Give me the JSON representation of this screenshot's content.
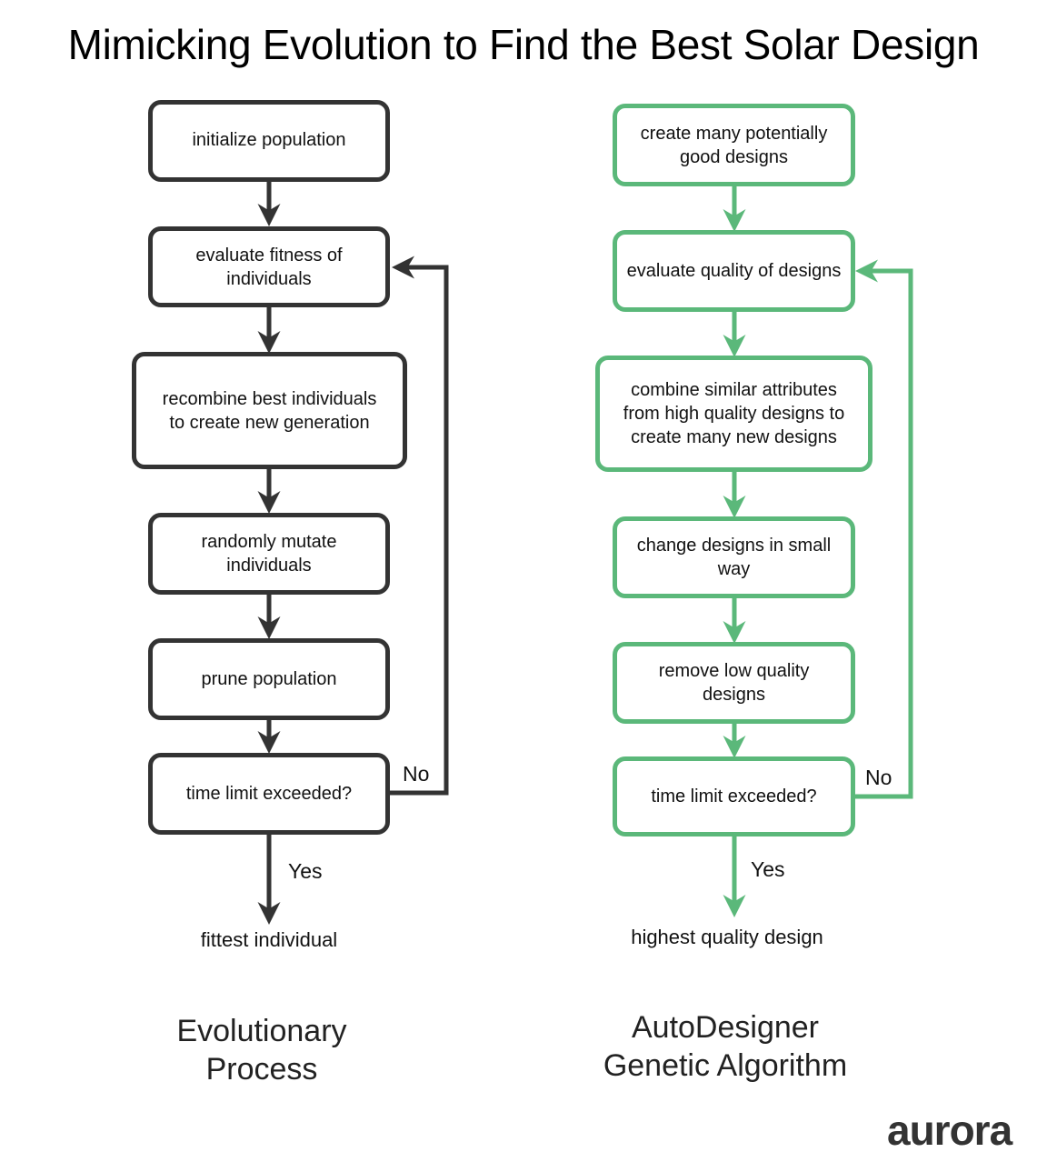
{
  "title": "Mimicking Evolution to Find the Best Solar Design",
  "colors": {
    "left_stroke": "#333333",
    "right_stroke": "#5bb87a"
  },
  "left": {
    "nodes": [
      "initialize population",
      "evaluate fitness of individuals",
      "recombine best individuals to create new generation",
      "randomly mutate individuals",
      "prune population",
      "time limit exceeded?"
    ],
    "no_label": "No",
    "yes_label": "Yes",
    "result": "fittest individual",
    "caption_line1": "Evolutionary",
    "caption_line2": "Process"
  },
  "right": {
    "nodes": [
      "create many potentially good designs",
      "evaluate quality of designs",
      "combine similar attributes from high quality designs to create many new designs",
      "change designs in small way",
      "remove low quality designs",
      "time limit exceeded?"
    ],
    "no_label": "No",
    "yes_label": "Yes",
    "result": "highest quality design",
    "caption_line1": "AutoDesigner",
    "caption_line2": "Genetic Algorithm"
  },
  "logo": "aurora"
}
